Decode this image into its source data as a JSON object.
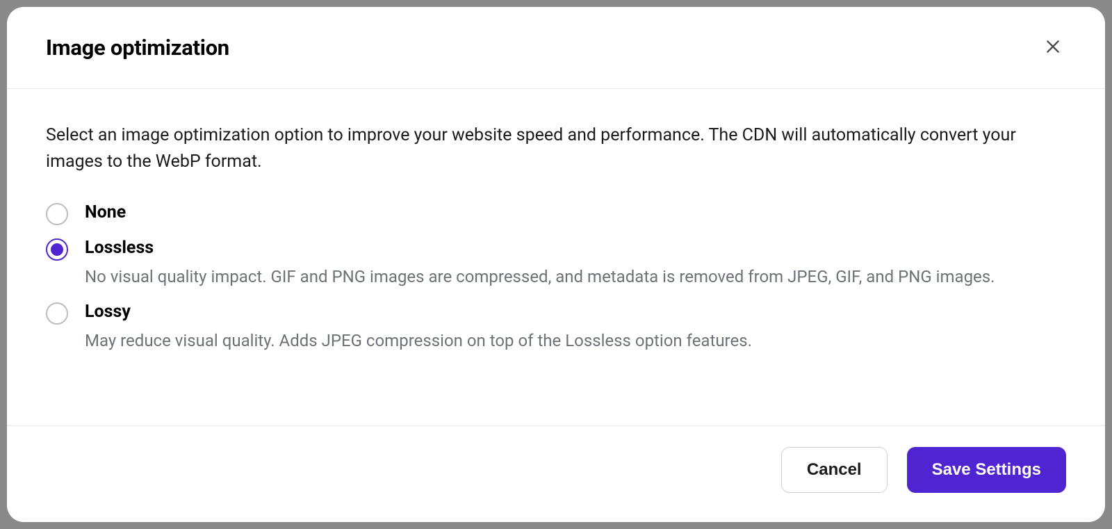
{
  "modal": {
    "title": "Image optimization",
    "description": "Select an image optimization option to improve your website speed and performance. The CDN will automatically convert your images to the WebP format.",
    "options": [
      {
        "label": "None",
        "description": "",
        "selected": false
      },
      {
        "label": "Lossless",
        "description": "No visual quality impact. GIF and PNG images are compressed, and metadata is removed from JPEG, GIF, and PNG images.",
        "selected": true
      },
      {
        "label": "Lossy",
        "description": "May reduce visual quality. Adds JPEG compression on top of the Lossless option features.",
        "selected": false
      }
    ],
    "buttons": {
      "cancel": "Cancel",
      "save": "Save Settings"
    }
  },
  "colors": {
    "accent": "#5025d1"
  }
}
